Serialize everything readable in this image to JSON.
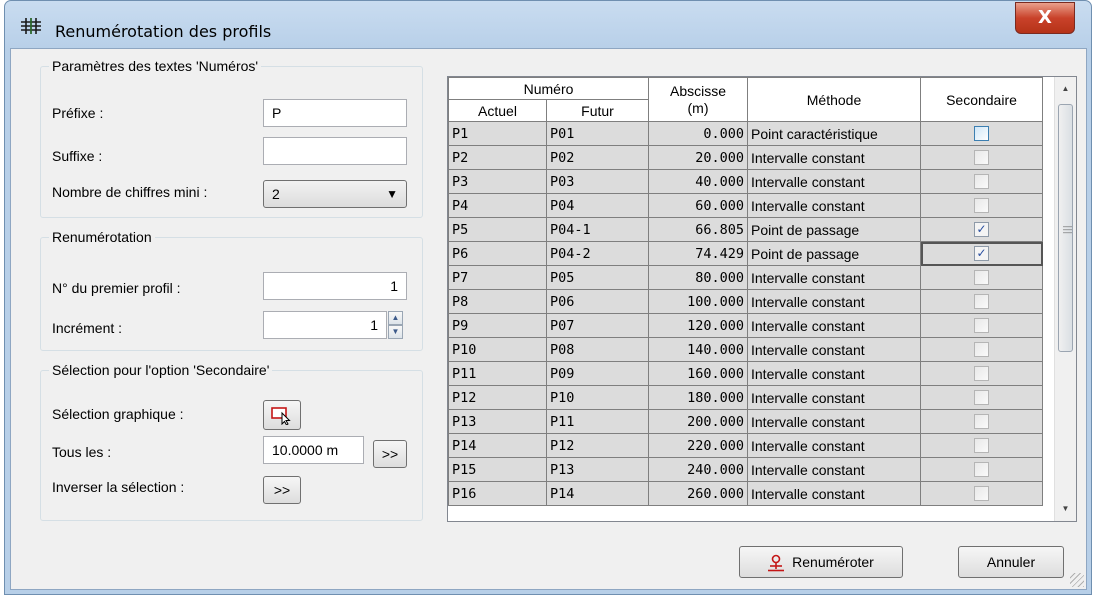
{
  "window": {
    "title": "Renumérotation des profils",
    "close_label": "X"
  },
  "texts_group": {
    "label": "Paramètres des textes 'Numéros'",
    "prefix_label": "Préfixe :",
    "prefix_value": "P",
    "suffix_label": "Suffixe :",
    "suffix_value": "",
    "digits_label": "Nombre de chiffres mini :",
    "digits_value": "2"
  },
  "renum_group": {
    "label": "Renumérotation",
    "first_label": "N° du premier profil :",
    "first_value": "1",
    "increment_label": "Incrément :",
    "increment_value": "1"
  },
  "secondary_group": {
    "label": "Sélection pour l'option 'Secondaire'",
    "graphic_label": "Sélection graphique :",
    "every_label": "Tous les :",
    "every_value": "10.0000 m",
    "every_button": ">>",
    "invert_label": "Inverser la sélection :",
    "invert_button": ">>"
  },
  "table": {
    "header_numero": "Numéro",
    "header_actuel": "Actuel",
    "header_futur": "Futur",
    "header_abscisse": "Abscisse",
    "header_abscisse_unit": "(m)",
    "header_methode": "Méthode",
    "header_secondaire": "Secondaire",
    "rows": [
      {
        "actuel": "P1",
        "futur": "P01",
        "abscisse": "0.000",
        "methode": "Point caractéristique",
        "secondaire": false
      },
      {
        "actuel": "P2",
        "futur": "P02",
        "abscisse": "20.000",
        "methode": "Intervalle constant",
        "secondaire": false
      },
      {
        "actuel": "P3",
        "futur": "P03",
        "abscisse": "40.000",
        "methode": "Intervalle constant",
        "secondaire": false
      },
      {
        "actuel": "P4",
        "futur": "P04",
        "abscisse": "60.000",
        "methode": "Intervalle constant",
        "secondaire": false
      },
      {
        "actuel": "P5",
        "futur": "P04-1",
        "abscisse": "66.805",
        "methode": "Point de passage",
        "secondaire": true
      },
      {
        "actuel": "P6",
        "futur": "P04-2",
        "abscisse": "74.429",
        "methode": "Point de passage",
        "secondaire": true
      },
      {
        "actuel": "P7",
        "futur": "P05",
        "abscisse": "80.000",
        "methode": "Intervalle constant",
        "secondaire": false
      },
      {
        "actuel": "P8",
        "futur": "P06",
        "abscisse": "100.000",
        "methode": "Intervalle constant",
        "secondaire": false
      },
      {
        "actuel": "P9",
        "futur": "P07",
        "abscisse": "120.000",
        "methode": "Intervalle constant",
        "secondaire": false
      },
      {
        "actuel": "P10",
        "futur": "P08",
        "abscisse": "140.000",
        "methode": "Intervalle constant",
        "secondaire": false
      },
      {
        "actuel": "P11",
        "futur": "P09",
        "abscisse": "160.000",
        "methode": "Intervalle constant",
        "secondaire": false
      },
      {
        "actuel": "P12",
        "futur": "P10",
        "abscisse": "180.000",
        "methode": "Intervalle constant",
        "secondaire": false
      },
      {
        "actuel": "P13",
        "futur": "P11",
        "abscisse": "200.000",
        "methode": "Intervalle constant",
        "secondaire": false
      },
      {
        "actuel": "P14",
        "futur": "P12",
        "abscisse": "220.000",
        "methode": "Intervalle constant",
        "secondaire": false
      },
      {
        "actuel": "P15",
        "futur": "P13",
        "abscisse": "240.000",
        "methode": "Intervalle constant",
        "secondaire": false
      },
      {
        "actuel": "P16",
        "futur": "P14",
        "abscisse": "260.000",
        "methode": "Intervalle constant",
        "secondaire": false
      }
    ]
  },
  "buttons": {
    "renumber": "Renuméroter",
    "cancel": "Annuler"
  },
  "icons": {
    "title": "grid-icon",
    "graphic_select": "cursor-select-icon",
    "renumber": "profile-marker-icon"
  },
  "colors": {
    "title_bar": "#b7cfe8",
    "close_button": "#c9422a",
    "row_background": "#dcdcdc",
    "check_mark": "#2a4fa0"
  }
}
